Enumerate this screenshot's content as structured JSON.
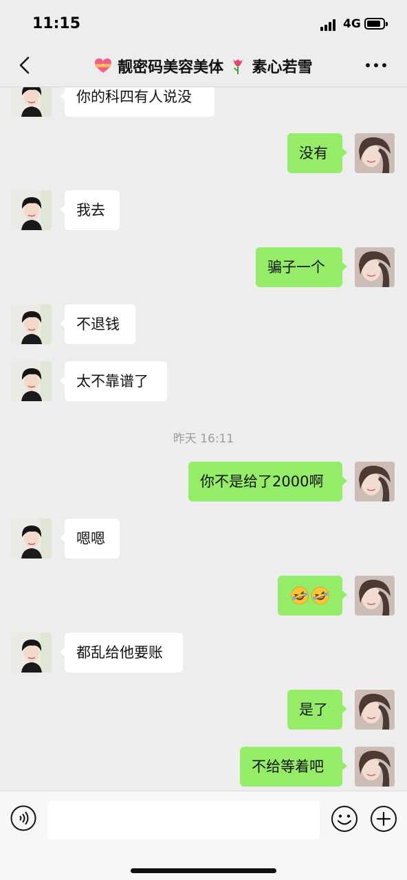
{
  "status_bar": {
    "time": "11:15",
    "network": "4G",
    "battery_level": 0.85
  },
  "nav": {
    "title": "靓密码美容美体",
    "title_suffix": "素心若雪"
  },
  "messages": [
    {
      "side": "in",
      "text": "你的科四有人说没"
    },
    {
      "side": "out",
      "text": "没有"
    },
    {
      "side": "in",
      "text": "我去"
    },
    {
      "side": "out",
      "text": "骗子一个"
    },
    {
      "side": "in",
      "text": "不退钱"
    },
    {
      "side": "in",
      "text": "太不靠谱了"
    },
    {
      "side": "out",
      "text": "你不是给了2000啊"
    },
    {
      "side": "in",
      "text": "嗯嗯"
    },
    {
      "side": "out",
      "text": "",
      "emoji": [
        "rolling-laughing-emoji",
        "rolling-laughing-emoji"
      ]
    },
    {
      "side": "in",
      "text": "都乱给他要账"
    },
    {
      "side": "out",
      "text": "是了"
    },
    {
      "side": "out",
      "text": "不给等着吧"
    }
  ],
  "timestamp": "昨天 16:11",
  "input": {
    "value": ""
  },
  "icons": {
    "back": "chevron-left-icon",
    "more": "more-dots-icon",
    "voice": "voice-icon",
    "emoji": "emoji-icon",
    "plus": "plus-icon",
    "heart": "heart-icon",
    "tulip": "tulip-icon"
  },
  "colors": {
    "background": "#ededed",
    "out_bubble": "#95ec69",
    "in_bubble": "#ffffff",
    "timestamp": "#9b9b9b"
  }
}
